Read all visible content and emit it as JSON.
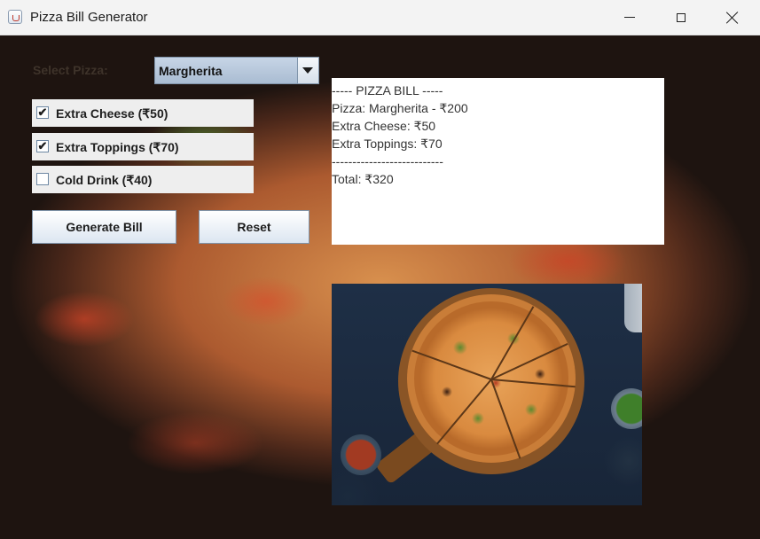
{
  "window": {
    "title": "Pizza Bill Generator"
  },
  "form": {
    "select_label": "Select Pizza:",
    "pizza_selected": "Margherita",
    "options": [
      {
        "label": "Extra Cheese (₹50)",
        "checked": true
      },
      {
        "label": "Extra Toppings (₹70)",
        "checked": true
      },
      {
        "label": "Cold Drink (₹40)",
        "checked": false
      }
    ],
    "generate_label": "Generate Bill",
    "reset_label": "Reset"
  },
  "bill": {
    "lines": [
      "----- PIZZA BILL -----",
      "Pizza: Margherita - ₹200",
      "Extra Cheese: ₹50",
      "Extra Toppings: ₹70",
      "---------------------------",
      "Total: ₹320"
    ]
  },
  "icons": {
    "app": "java-cup-icon",
    "minimize": "minimize-icon",
    "maximize": "maximize-icon",
    "close": "close-icon",
    "dropdown": "chevron-down-icon",
    "check": "check-icon"
  },
  "colors": {
    "button_gradient_top": "#ffffff",
    "button_gradient_bottom": "#dce6f1",
    "combo_bg": "#b8c8db",
    "bill_bg": "#ffffff"
  }
}
